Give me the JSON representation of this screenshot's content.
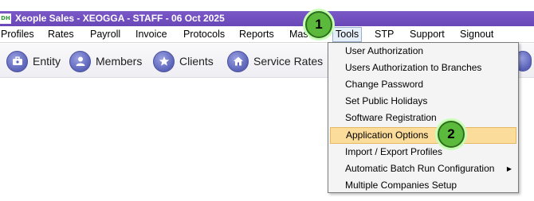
{
  "window": {
    "title": "Xeople Sales - XEOGGA - STAFF - 06 Oct 2025",
    "app_icon_text": "DH"
  },
  "menubar": {
    "items": [
      {
        "label": "Profiles"
      },
      {
        "label": "Rates"
      },
      {
        "label": "Payroll"
      },
      {
        "label": "Invoice"
      },
      {
        "label": "Protocols"
      },
      {
        "label": "Reports"
      },
      {
        "label": "Mas"
      },
      {
        "label": "Tools"
      },
      {
        "label": "STP"
      },
      {
        "label": "Support"
      },
      {
        "label": "Signout"
      }
    ]
  },
  "toolbar": {
    "buttons": [
      {
        "label": "Entity",
        "icon": "briefcase-icon"
      },
      {
        "label": "Members",
        "icon": "person-icon"
      },
      {
        "label": "Clients",
        "icon": "star-icon"
      },
      {
        "label": "Service Rates",
        "icon": "house-icon"
      }
    ]
  },
  "tools_menu": {
    "items": [
      {
        "label": "User Authorization",
        "highlighted": false,
        "has_submenu": false
      },
      {
        "label": "Users Authorization to Branches",
        "highlighted": false,
        "has_submenu": false
      },
      {
        "label": "Change Password",
        "highlighted": false,
        "has_submenu": false
      },
      {
        "label": "Set Public Holidays",
        "highlighted": false,
        "has_submenu": false
      },
      {
        "label": "Software Registration",
        "highlighted": false,
        "has_submenu": false
      },
      {
        "label": "Application Options",
        "highlighted": true,
        "has_submenu": false
      },
      {
        "label": "Import / Export Profiles",
        "highlighted": false,
        "has_submenu": false
      },
      {
        "label": "Automatic Batch Run Configuration",
        "highlighted": false,
        "has_submenu": true
      },
      {
        "label": "Multiple Companies Setup",
        "highlighted": false,
        "has_submenu": false
      }
    ],
    "submenu_arrow": "▶"
  },
  "callouts": [
    {
      "number": "1"
    },
    {
      "number": "2"
    }
  ],
  "colors": {
    "titlebar": "#6a47b8",
    "highlight": "#fcdc9a",
    "callout": "#5bba3c"
  }
}
